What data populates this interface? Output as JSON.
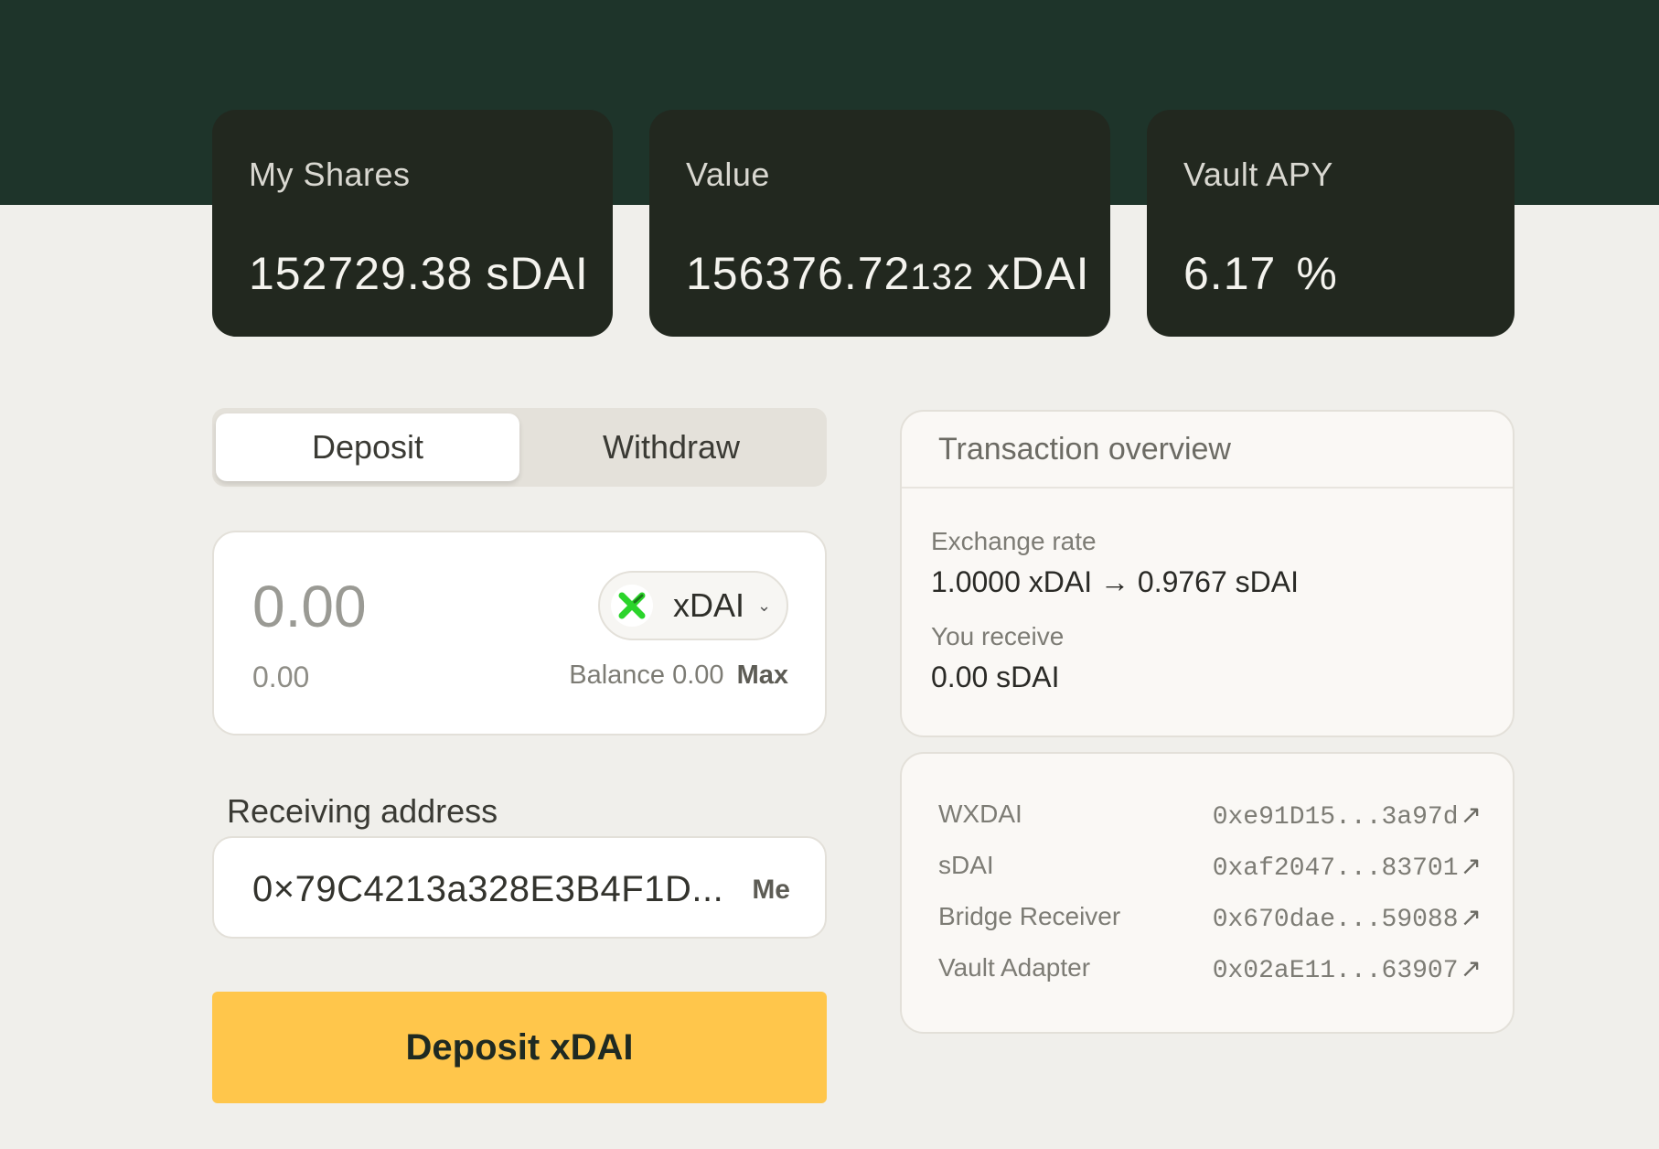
{
  "stats": {
    "shares": {
      "label": "My Shares",
      "value": "152729.38",
      "unit": "sDAI"
    },
    "value": {
      "label": "Value",
      "value_main": "156376.72",
      "value_small": "132",
      "unit": "xDAI"
    },
    "apy": {
      "label": "Vault APY",
      "value": "6.17",
      "unit": "%"
    }
  },
  "tabs": {
    "deposit": "Deposit",
    "withdraw": "Withdraw",
    "active": "Deposit"
  },
  "amount": {
    "value": "0.00",
    "usd_value": "0.00",
    "token": "xDAI",
    "balance_text": "Balance 0.00",
    "max_label": "Max"
  },
  "receiving": {
    "label": "Receiving address",
    "address": "0×79C4213a328E3B4F1D...",
    "me_label": "Me"
  },
  "deposit_button": "Deposit xDAI",
  "overview": {
    "title": "Transaction overview",
    "exchange_rate_label": "Exchange rate",
    "exchange_rate_value": "1.0000 xDAI → 0.9767 sDAI",
    "receive_label": "You receive",
    "receive_value": "0.00 sDAI"
  },
  "contracts": [
    {
      "name": "WXDAI",
      "address": "0xe91D15...3a97d"
    },
    {
      "name": "sDAI",
      "address": "0xaf2047...83701"
    },
    {
      "name": "Bridge Receiver",
      "address": "0x670dae...59088"
    },
    {
      "name": "Vault Adapter",
      "address": "0x02aE11...63907"
    }
  ],
  "colors": {
    "header_band": "#1e342a",
    "stat_card": "#22281f",
    "page_bg": "#f0efeb",
    "accent_button": "#ffc64b",
    "token_logo_green": "#2bd42b"
  },
  "icons": {
    "token": "xdai-logo-icon",
    "dropdown": "chevron-down-icon",
    "external": "external-link-icon"
  }
}
